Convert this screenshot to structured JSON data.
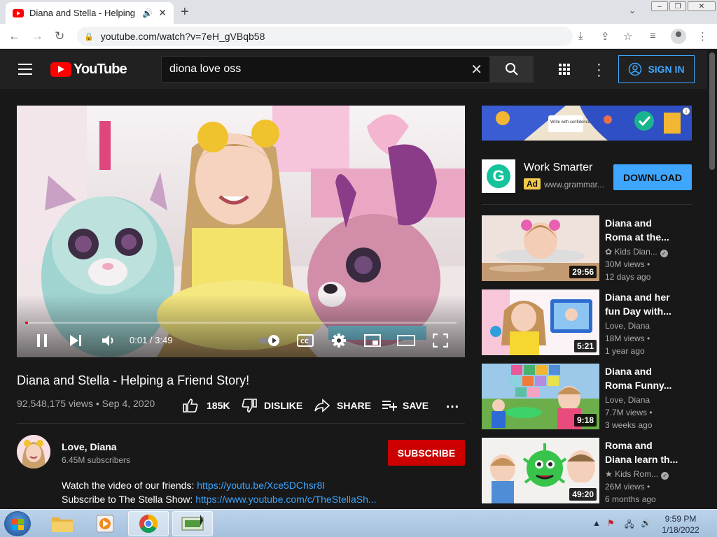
{
  "browser": {
    "tab_title": "Diana and Stella - Helping a",
    "url": "youtube.com/watch?v=7eH_gVBqb58"
  },
  "youtube": {
    "logo_text": "YouTube",
    "search_query": "diona love oss",
    "sign_in_label": "SIGN IN"
  },
  "player": {
    "time": "0:01 / 3:49",
    "progress_fraction": 0.005
  },
  "video": {
    "title": "Diana and Stella - Helping a Friend Story!",
    "meta": "92,548,175 views • Sep 4, 2020",
    "likes": "185K",
    "dislike_label": "DISLIKE",
    "share_label": "SHARE",
    "save_label": "SAVE"
  },
  "channel": {
    "name": "Love, Diana",
    "subscribers": "6.45M subscribers",
    "subscribe_label": "SUBSCRIBE"
  },
  "description": {
    "line1_text": "Watch the video of our friends: ",
    "line1_link": "https://youtu.be/Xce5DChsr8I",
    "line2_text": "Subscribe to The Stella Show: ",
    "line2_link": "https://www.youtube.com/c/TheStellaSh..."
  },
  "ad": {
    "banner_text": "Write with confidence",
    "title": "Work Smarter",
    "badge": "Ad",
    "url": "www.grammar...",
    "cta": "DOWNLOAD"
  },
  "recommendations": [
    {
      "title1": "Diana and",
      "title2": "Roma at the...",
      "channel": "✿ Kids Dian...",
      "verified": true,
      "views": "30M views •",
      "age": "12 days ago",
      "duration": "29:56"
    },
    {
      "title1": "Diana and her",
      "title2": "fun Day with...",
      "channel": "Love, Diana",
      "verified": false,
      "views": "18M views •",
      "age": "1 year ago",
      "duration": "5:21"
    },
    {
      "title1": "Diana and",
      "title2": "Roma Funny...",
      "channel": "Love, Diana",
      "verified": false,
      "views": "7.7M views •",
      "age": "3 weeks ago",
      "duration": "9:18"
    },
    {
      "title1": "Roma and",
      "title2": "Diana learn th...",
      "channel": "★ Kids Rom...",
      "verified": true,
      "views": "26M views •",
      "age": "6 months ago",
      "duration": "49:20"
    }
  ],
  "taskbar": {
    "time": "9:59 PM",
    "date": "1/18/2022"
  },
  "colors": {
    "yt_red": "#ff0000",
    "link_blue": "#3ea6ff",
    "subscribe_red": "#cc0000",
    "background": "#181818"
  }
}
